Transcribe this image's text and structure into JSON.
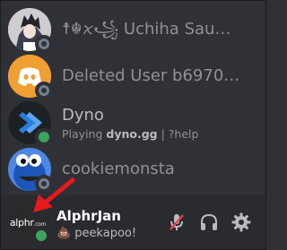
{
  "members": [
    {
      "name": "☨☬ꪎ꧁ Uchiha Sau…",
      "status": "offline",
      "activity_prefix": "",
      "activity_bold": "",
      "activity_suffix": ""
    },
    {
      "name": "Deleted User b6970…",
      "status": "offline",
      "activity_prefix": "",
      "activity_bold": "",
      "activity_suffix": ""
    },
    {
      "name": "Dyno",
      "status": "online",
      "activity_prefix": "Playing ",
      "activity_bold": "dyno.gg",
      "activity_suffix": " | ?help"
    },
    {
      "name": "cookiemonsta",
      "status": "offline",
      "activity_prefix": "",
      "activity_bold": "",
      "activity_suffix": ""
    }
  ],
  "user_panel": {
    "avatar_text": "alphr",
    "avatar_suffix": ".com",
    "username": "AlphrJan",
    "custom_status_emoji": "💩",
    "custom_status": "peekapoo!",
    "status": "online"
  },
  "controls": {
    "mute_icon": "mic-muted-icon",
    "deafen_icon": "headphones-icon",
    "settings_icon": "gear-icon"
  },
  "colors": {
    "background": "#2f3136",
    "panel": "#292b2f",
    "online": "#3ba55d",
    "offline": "#747f8d",
    "muted": "#ed4245",
    "blurple": "#5865f2",
    "arrow": "#e8191a"
  }
}
